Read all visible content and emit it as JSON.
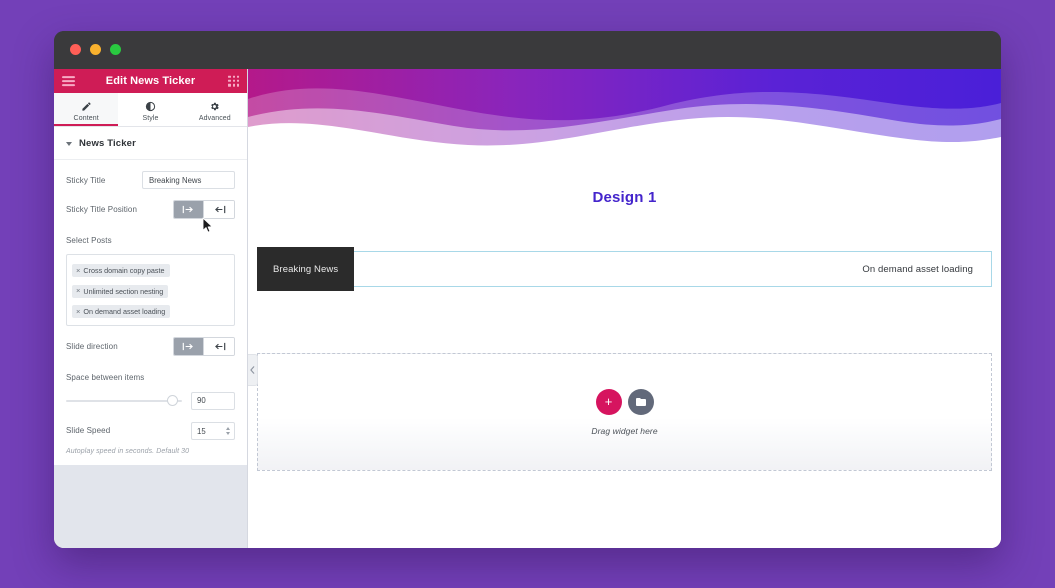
{
  "window": {
    "traffic_lights": [
      "close",
      "minimize",
      "maximize"
    ]
  },
  "panel": {
    "header": {
      "title": "Edit News Ticker",
      "menu_icon": "hamburger-icon",
      "apps_icon": "grid-icon"
    },
    "tabs": [
      {
        "label": "Content",
        "icon": "pencil-icon",
        "active": true
      },
      {
        "label": "Style",
        "icon": "contrast-icon",
        "active": false
      },
      {
        "label": "Advanced",
        "icon": "gear-icon",
        "active": false
      }
    ],
    "section": {
      "title": "News Ticker",
      "expanded": true
    },
    "controls": {
      "sticky_title": {
        "label": "Sticky Title",
        "value": "Breaking News"
      },
      "sticky_title_position": {
        "label": "Sticky Title Position",
        "options": [
          "align-left",
          "align-right"
        ],
        "selected": "align-left"
      },
      "select_posts": {
        "label": "Select Posts",
        "tags": [
          "Cross domain copy paste",
          "Unlimited section nesting",
          "On demand asset loading"
        ],
        "remove_glyph": "×"
      },
      "slide_direction": {
        "label": "Slide direction",
        "options": [
          "align-left",
          "align-right"
        ],
        "selected": "align-left"
      },
      "space_between_items": {
        "label": "Space between items",
        "value": "90",
        "percent": 87
      },
      "slide_speed": {
        "label": "Slide Speed",
        "value": "15"
      },
      "help_text": "Autoplay speed in seconds. Default 30"
    }
  },
  "canvas": {
    "design_title": "Design 1",
    "ticker": {
      "sticky_label": "Breaking News",
      "item_text": "On demand asset loading"
    },
    "dropzone": {
      "label": "Drag widget here",
      "add_icon": "plus-icon",
      "folder_icon": "folder-icon"
    },
    "collapse_handle_icon": "chevron-left-icon"
  },
  "colors": {
    "page_background": "#7340b8",
    "panel_header": "#cf1c56",
    "accent_pink": "#d6145f",
    "design_title": "#4425cc",
    "ticker_border": "#a8d8e8",
    "sticky_label_bg": "#2b2b2b"
  }
}
